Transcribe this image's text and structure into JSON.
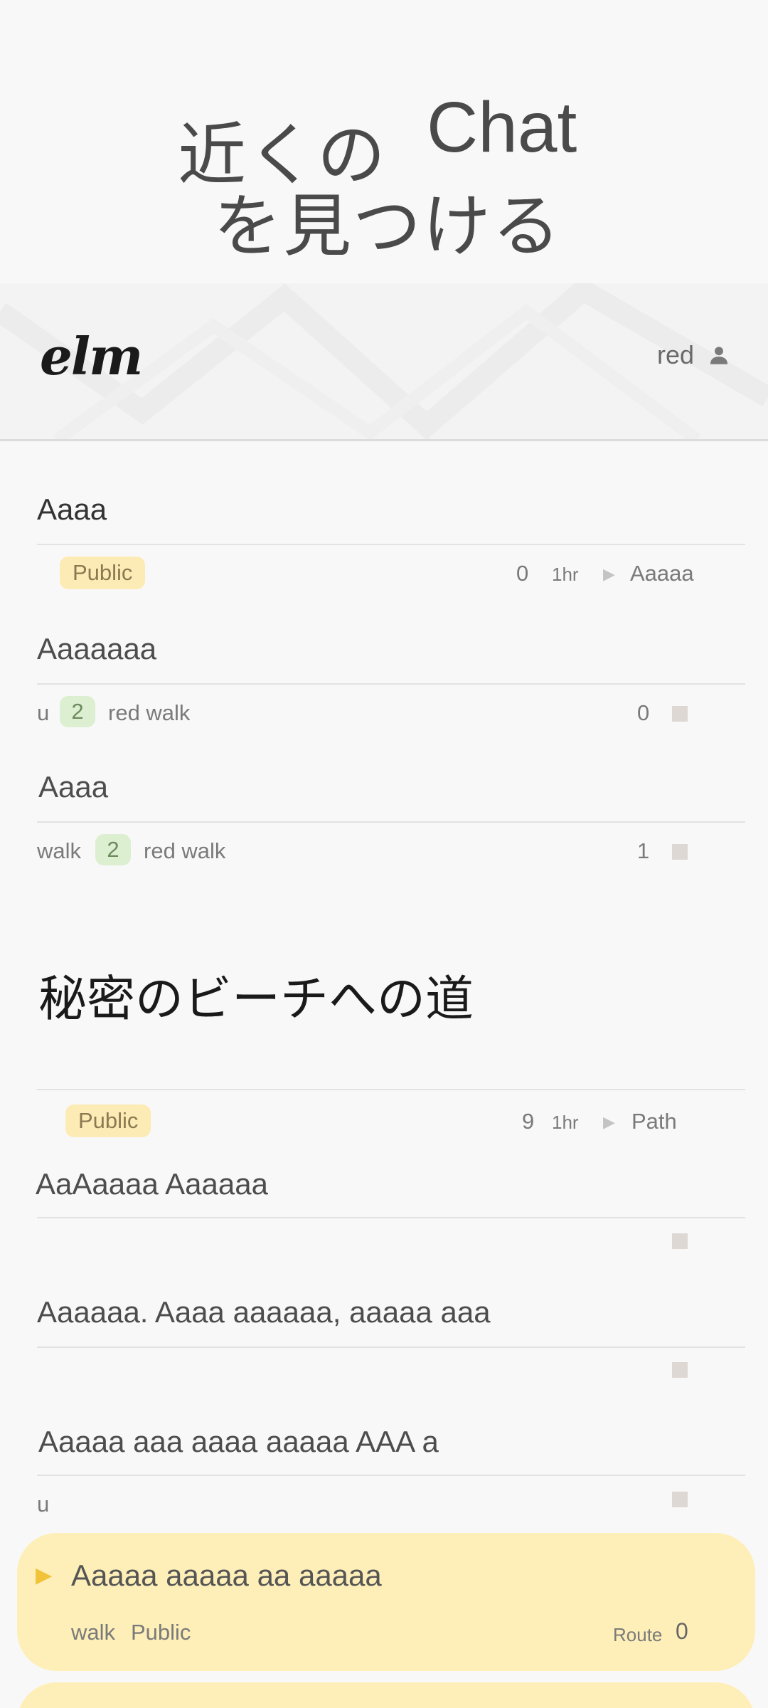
{
  "hero": {
    "line1": "近くの",
    "chat": "Chat",
    "line2": "を見つける"
  },
  "header": {
    "logo": "elm",
    "user_name": "red",
    "user_icon": "person-icon"
  },
  "chats": [
    {
      "title": "Aaaa",
      "badge": "Public",
      "count": "0",
      "time": "1hr",
      "author": "Aaaaa"
    },
    {
      "title": "Aaaaaaa",
      "user": "u",
      "badge_num": "2",
      "members": "red walk",
      "count": "0"
    },
    {
      "title": "Aaaa",
      "user": "walk",
      "badge_num": "2",
      "members": "red walk",
      "count": "1"
    }
  ],
  "section": {
    "title": "秘密のビーチへの道",
    "badge": "Public",
    "count": "9",
    "time": "1hr",
    "author": "Path"
  },
  "posts": [
    {
      "title": "AaAaaaa Aaaaaa",
      "user": ""
    },
    {
      "title": "Aaaaaa. Aaaa aaaaaa, aaaaa aaa",
      "user": ""
    },
    {
      "title": "Aaaaa aaa aaaa aaaaa AAA a",
      "user": "u"
    }
  ],
  "route_card": {
    "title": "Aaaaa aaaaa aa aaaaa",
    "user": "walk",
    "visibility": "Public",
    "label": "Route",
    "count": "0"
  },
  "colors": {
    "accent_yellow": "#feefb8",
    "badge_green": "#dcefd0",
    "badge_yellow": "#fdebb5"
  }
}
